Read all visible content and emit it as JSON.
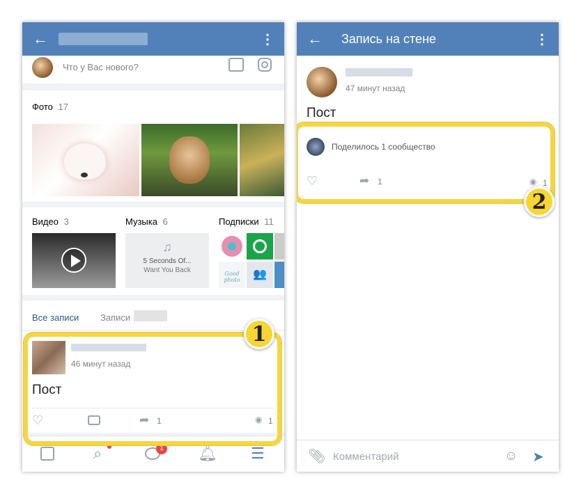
{
  "left": {
    "composer_placeholder": "Что у Вас нового?",
    "photos": {
      "label": "Фото",
      "count": "17"
    },
    "videos": {
      "label": "Видео",
      "count": "3"
    },
    "music": {
      "label": "Музыка",
      "count": "6",
      "track_title": "5 Seconds Of...",
      "track_artist": "Want You Back"
    },
    "subscriptions": {
      "label": "Подписки",
      "count": "11",
      "tile_text": "Good photo"
    },
    "tabs": {
      "all": "Все записи",
      "own": "Записи"
    },
    "post": {
      "time": "46 минут назад",
      "text": "Пост",
      "shares": "1",
      "views": "1"
    },
    "nav": {
      "messages_badge": "1"
    },
    "badge": "1"
  },
  "right": {
    "title": "Запись на стене",
    "post": {
      "time": "47 минут назад",
      "text": "Пост",
      "shared_by": "Поделилось 1 сообщество",
      "shares": "1",
      "views": "1"
    },
    "comment_placeholder": "Комментарий",
    "badge": "2"
  }
}
